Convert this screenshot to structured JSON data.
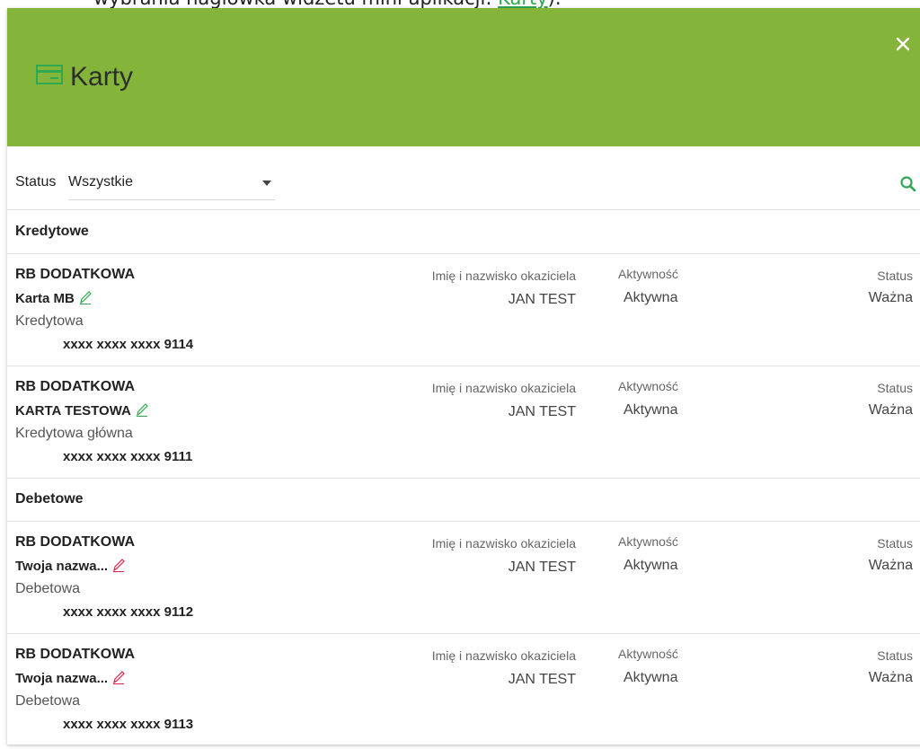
{
  "document": {
    "intro_text": "wybrania nagłówka widżetu mini aplikacji",
    "link_text": "Karty",
    "after_link": ")."
  },
  "modal": {
    "title": "Karty",
    "header_color": "#84b53a",
    "icons": {
      "header": "card-icon",
      "close": "close-icon",
      "search": "search-icon",
      "edit": "pencil-icon"
    }
  },
  "filter": {
    "label": "Status",
    "value": "Wszystkie"
  },
  "columns": {
    "holder": "Imię i nazwisko okaziciela",
    "activity": "Aktywność",
    "status": "Status"
  },
  "sections": [
    {
      "title": "Kredytowe",
      "cards": [
        {
          "product": "RB DODATKOWA",
          "name": "Karta MB",
          "edit_color": "#2fa84f",
          "type": "Kredytowa",
          "number": "xxxx xxxx xxxx 9114",
          "holder": "JAN TEST",
          "activity": "Aktywna",
          "status": "Ważna"
        },
        {
          "product": "RB DODATKOWA",
          "name": "KARTA TESTOWA",
          "edit_color": "#2fa84f",
          "type": "Kredytowa główna",
          "number": "xxxx xxxx xxxx 9111",
          "holder": "JAN TEST",
          "activity": "Aktywna",
          "status": "Ważna"
        }
      ]
    },
    {
      "title": "Debetowe",
      "cards": [
        {
          "product": "RB DODATKOWA",
          "name": "Twoja nazwa...",
          "edit_color": "#e0204a",
          "type": "Debetowa",
          "number": "xxxx xxxx xxxx 9112",
          "holder": "JAN TEST",
          "activity": "Aktywna",
          "status": "Ważna"
        },
        {
          "product": "RB DODATKOWA",
          "name": "Twoja nazwa...",
          "edit_color": "#e0204a",
          "type": "Debetowa",
          "number": "xxxx xxxx xxxx 9113",
          "holder": "JAN TEST",
          "activity": "Aktywna",
          "status": "Ważna"
        }
      ]
    }
  ]
}
